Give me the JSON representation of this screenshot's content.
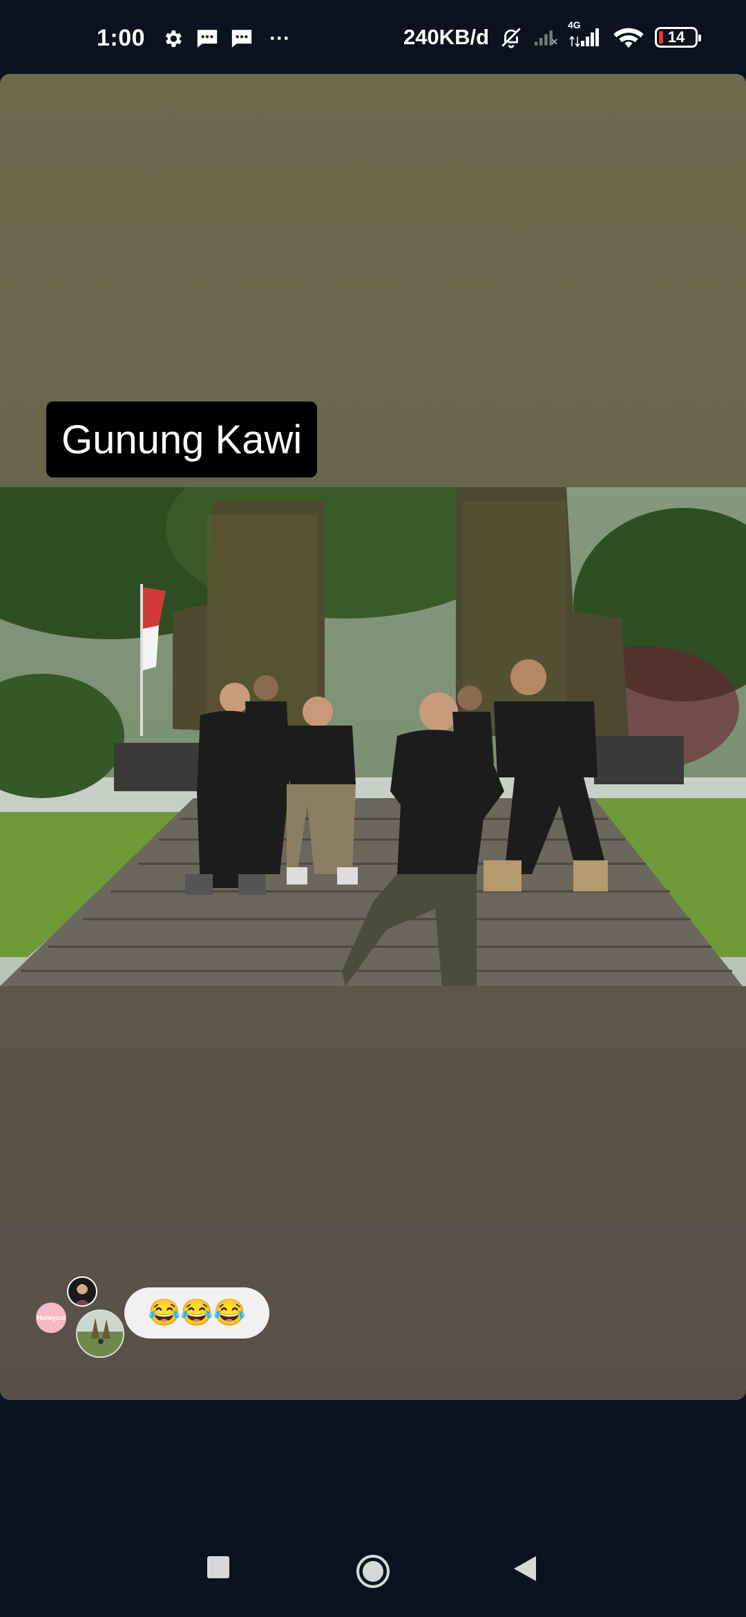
{
  "status_bar": {
    "time": "1:00",
    "left_icons": [
      "gear-icon",
      "message-icon",
      "message-icon",
      "more-dots-icon"
    ],
    "more_label": "···",
    "data_speed": "240KB/d",
    "right_icons": [
      "mute-icon",
      "signal-icon",
      "signal-4g-icon",
      "wifi-icon",
      "battery-icon"
    ],
    "network_label": "4G",
    "battery_level": "14"
  },
  "story": {
    "caption": "Gunung Kawi",
    "photo_icon": "group-photo-icon"
  },
  "reactions": {
    "avatar_label": "Honeycut",
    "message": "😂😂😂"
  },
  "nav_bar": {
    "buttons": [
      "recents-icon",
      "home-icon",
      "back-icon"
    ]
  },
  "colors": {
    "background": "#0c1220",
    "card_top": "#6b6b4e",
    "card_bottom": "#57504a",
    "caption_bg": "#000000",
    "battery_low": "#e53935"
  }
}
